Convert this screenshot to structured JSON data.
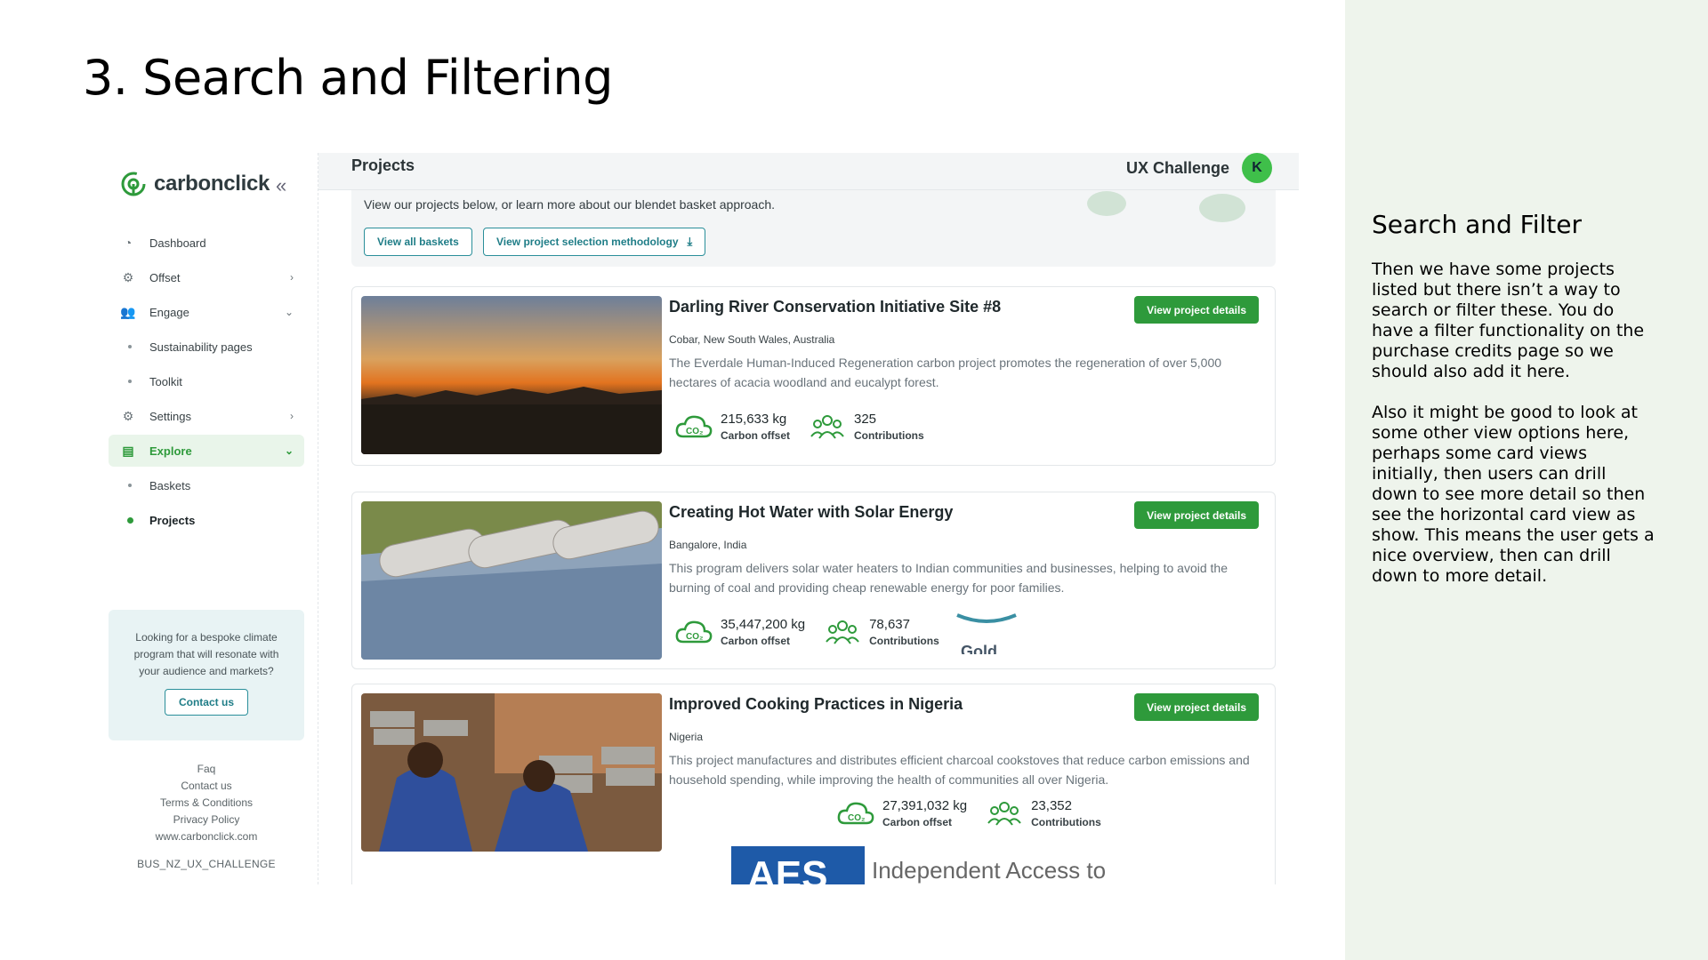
{
  "slide": {
    "title": "3. Search and Filtering",
    "notes": {
      "heading": "Search and Filter",
      "paragraph1": "Then we have some projects listed but there isn’t a way to search or filter these. You do have a filter functionality on the purchase credits page so we should also add it here.",
      "paragraph2": "Also it might be good to look at some other view options here, perhaps some card views initially, then users can drill down to see more detail so then see the horizontal card view as show. This means the user gets a nice overview, then can drill down to more detail."
    }
  },
  "app": {
    "brand": "carbonclick",
    "colors": {
      "accent": "#2e9a3b",
      "teal": "#1f7d87",
      "topbar": "#f3f5f6"
    },
    "sidebar": {
      "items": [
        {
          "label": "Dashboard",
          "icon": "dashboard-icon"
        },
        {
          "label": "Offset",
          "icon": "offset-icon"
        },
        {
          "label": "Engage",
          "icon": "engage-icon"
        },
        {
          "label": "Sustainability pages"
        },
        {
          "label": "Toolkit"
        },
        {
          "label": "Settings",
          "icon": "settings-icon"
        },
        {
          "label": "Explore",
          "icon": "explore-icon",
          "active": true
        },
        {
          "label": "Baskets"
        },
        {
          "label": "Projects",
          "current": true
        }
      ],
      "promo": {
        "text": "Looking for a bespoke climate program that will resonate with your audience and markets?",
        "button": "Contact us"
      },
      "footer": [
        "Faq",
        "Contact us",
        "Terms & Conditions",
        "Privacy Policy",
        "www.carbonclick.com"
      ],
      "account_code": "BUS_NZ_UX_CHALLENGE"
    },
    "topbar": {
      "title": "Projects",
      "user": "UX Challenge",
      "avatar": "K"
    },
    "intro": {
      "text": "View our projects below, or learn more about our blendet basket approach.",
      "btn_all_baskets": "View all baskets",
      "btn_methodology": "View project selection methodology"
    },
    "projects": [
      {
        "title": "Darling River Conservation Initiative Site #8",
        "location": "Cobar, New South Wales, Australia",
        "description": "The Everdale Human-Induced Regeneration carbon project promotes the regeneration of over 5,000 hectares of acacia woodland and eucalypt forest.",
        "carbon": "215,633 kg",
        "carbon_label": "Carbon offset",
        "contributions": "325",
        "contributions_label": "Contributions",
        "button": "View project details"
      },
      {
        "title": "Creating Hot Water with Solar Energy",
        "location": "Bangalore, India",
        "description": "This program delivers solar water heaters to Indian communities and businesses, helping to avoid the burning of coal and providing cheap renewable energy for poor families.",
        "carbon": "35,447,200 kg",
        "carbon_label": "Carbon offset",
        "contributions": "78,637",
        "contributions_label": "Contributions",
        "button": "View project details",
        "badge_partial": "Gold"
      },
      {
        "title": "Improved Cooking Practices in Nigeria",
        "location": "Nigeria",
        "description": "This project manufactures and distributes efficient charcoal cookstoves that reduce carbon emissions and household spending, while improving the health of communities all over Nigeria.",
        "carbon": "27,391,032 kg",
        "carbon_label": "Carbon offset",
        "contributions": "23,352",
        "contributions_label": "Contributions",
        "button": "View project details",
        "banner_logo": "AES",
        "banner_text": "Independent Access to"
      }
    ]
  }
}
